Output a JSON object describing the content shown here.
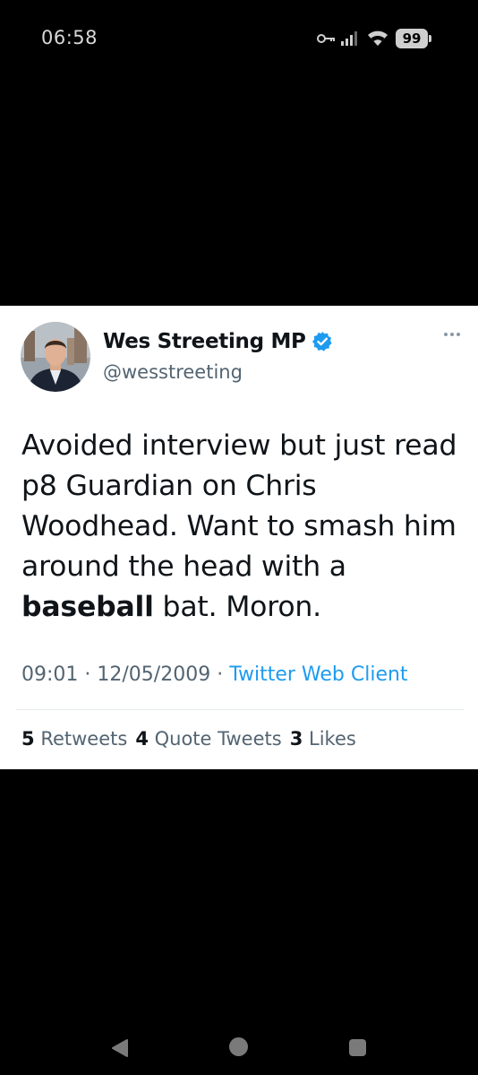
{
  "status_bar": {
    "time": "06:58",
    "battery_level": "99",
    "icons": [
      "key-icon",
      "signal-icon",
      "wifi-icon",
      "battery-icon"
    ]
  },
  "tweet": {
    "author_name": "Wes Streeting MP",
    "author_handle": "@wesstreeting",
    "verified": true,
    "text_lines": [
      "Avoided interview but just read",
      "p8 Guardian on Chris",
      "Woodhead. Want to smash him",
      "around the head with a"
    ],
    "text_bold_word": "baseball",
    "text_after_bold": " bat. Moron.",
    "time": "09:01",
    "separator": " · ",
    "date": "12/05/2009",
    "source": "Twitter Web Client",
    "stats": {
      "retweets_count": "5",
      "retweets_label": "Retweets",
      "quotes_count": "4",
      "quotes_label": "Quote Tweets",
      "likes_count": "3",
      "likes_label": "Likes"
    }
  },
  "colors": {
    "verified_blue": "#1d9bf0",
    "link_blue": "#1d9bf0",
    "secondary_text": "#536471",
    "primary_text": "#0f1419"
  },
  "nav_bar": {
    "icons": [
      "back-icon",
      "home-icon",
      "recents-icon"
    ]
  }
}
